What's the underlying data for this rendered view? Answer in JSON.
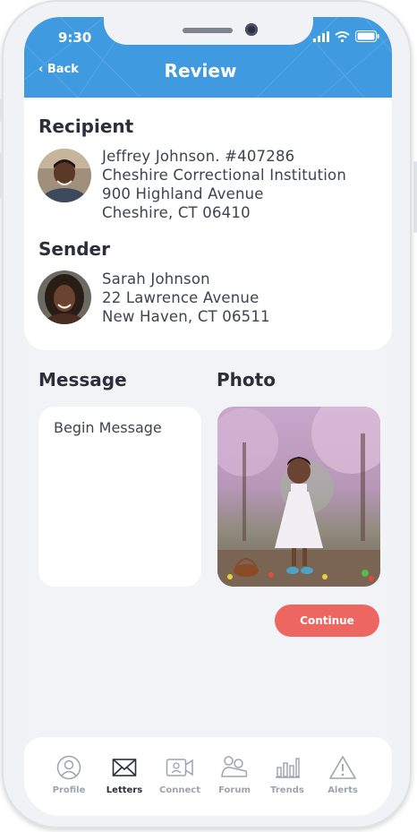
{
  "status_bar": {
    "time": "9:30"
  },
  "header": {
    "back_label": "Back",
    "title": "Review"
  },
  "recipient": {
    "heading": "Recipient",
    "lines": [
      "Jeffrey Johnson. #407286",
      "Cheshire Correctional Institution",
      "900 Highland Avenue",
      "Cheshire, CT 06410"
    ]
  },
  "sender": {
    "heading": "Sender",
    "lines": [
      "Sarah Johnson",
      "22 Lawrence Avenue",
      "New Haven, CT 06511"
    ]
  },
  "message": {
    "heading": "Message",
    "placeholder": "Begin Message"
  },
  "photo": {
    "heading": "Photo"
  },
  "continue_label": "Continue",
  "tabs": [
    {
      "label": "Profile",
      "icon": "user-circle-icon"
    },
    {
      "label": "Letters",
      "icon": "envelope-icon"
    },
    {
      "label": "Connect",
      "icon": "video-call-icon"
    },
    {
      "label": "Forum",
      "icon": "forum-people-icon"
    },
    {
      "label": "Trends",
      "icon": "chart-icon"
    },
    {
      "label": "Alerts",
      "icon": "warning-icon"
    }
  ],
  "colors": {
    "header_blue": "#3f9ae0",
    "continue_red": "#ee6660",
    "background": "#f1f3f6"
  },
  "active_tab": "Letters"
}
